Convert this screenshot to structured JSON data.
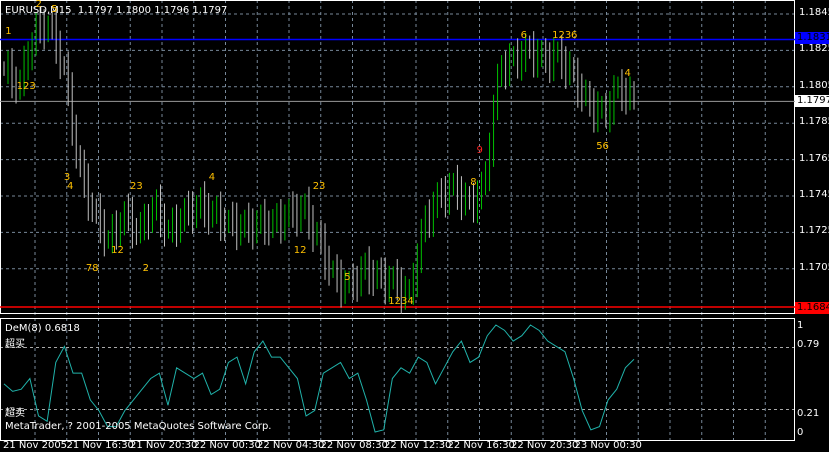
{
  "header": {
    "symbol": "EURUSD,M15",
    "open": "1.1797",
    "high": "1.1800",
    "low": "1.1796",
    "close": "1.1797"
  },
  "price_axis": {
    "ticks": [
      "1.1845",
      "1.1825",
      "1.1805",
      "1.1785",
      "1.1765",
      "1.1745",
      "1.1725",
      "1.1705"
    ],
    "tick_values": [
      1.1845,
      1.1825,
      1.1805,
      1.1785,
      1.1765,
      1.1745,
      1.1725,
      1.1705
    ],
    "blue_line": "1.1831",
    "current": "1.1797",
    "red_line": "1.1684"
  },
  "indicator": {
    "title": "DeM(8) 0.6818",
    "overbought_label": "超买",
    "oversold_label": "超卖",
    "ticks": [
      "1",
      "0.79",
      "0.21",
      "0"
    ],
    "copyright": "MetaTrader, ? 2001-2005 MetaQuotes Software Corp."
  },
  "time_axis": [
    "21 Nov 2005",
    "21 Nov 16:30",
    "21 Nov 20:30",
    "22 Nov 00:30",
    "22 Nov 04:30",
    "22 Nov 08:30",
    "22 Nov 12:30",
    "22 Nov 16:30",
    "22 Nov 20:30",
    "23 Nov 00:30"
  ],
  "colors": {
    "blue": "#0000ff",
    "red": "#ff0000",
    "up": "#00c000",
    "bar": "#c0c0c0",
    "dem": "#20b2aa",
    "label": "#ffc000"
  },
  "chart_data": {
    "type": "bar",
    "price_path": [
      1.1815,
      1.1805,
      1.1835,
      1.184,
      1.1815,
      1.176,
      1.1735,
      1.172,
      1.1735,
      1.1725,
      1.174,
      1.1725,
      1.1735,
      1.174,
      1.1735,
      1.173,
      1.1728,
      1.173,
      1.173,
      1.1735,
      1.1738,
      1.172,
      1.17,
      1.1695,
      1.1705,
      1.17,
      1.1698,
      1.169,
      1.173,
      1.1745,
      1.175,
      1.174,
      1.175,
      1.1815,
      1.182,
      1.1825,
      1.182,
      1.1822,
      1.181,
      1.1795,
      1.179,
      1.1805,
      1.1797
    ],
    "dem": [
      0.45,
      0.38,
      0.4,
      0.5,
      0.15,
      0.1,
      0.65,
      0.8,
      0.55,
      0.55,
      0.3,
      0.2,
      0.05,
      0.05,
      0.2,
      0.3,
      0.4,
      0.5,
      0.55,
      0.25,
      0.6,
      0.55,
      0.5,
      0.55,
      0.35,
      0.4,
      0.65,
      0.7,
      0.45,
      0.75,
      0.85,
      0.7,
      0.7,
      0.6,
      0.5,
      0.15,
      0.2,
      0.55,
      0.6,
      0.65,
      0.5,
      0.55,
      0.3,
      0.0,
      0.02,
      0.5,
      0.6,
      0.55,
      0.7,
      0.65,
      0.45,
      0.6,
      0.75,
      0.85,
      0.65,
      0.7,
      0.9,
      1.0,
      0.95,
      0.85,
      0.9,
      1.0,
      0.95,
      0.85,
      0.8,
      0.75,
      0.5,
      0.2,
      0.02,
      0.05,
      0.3,
      0.4,
      0.6,
      0.68
    ],
    "labels": [
      [
        "1",
        0.002,
        1.1835
      ],
      [
        "2",
        0.05,
        1.185
      ],
      [
        "34",
        0.065,
        1.1855
      ],
      [
        "5",
        0.075,
        1.1847
      ],
      [
        "123",
        0.02,
        1.1805
      ],
      [
        "3",
        0.095,
        1.1755
      ],
      [
        "4",
        0.1,
        1.175
      ],
      [
        "78",
        0.13,
        1.1705
      ],
      [
        "12",
        0.17,
        1.1715
      ],
      [
        "2",
        0.22,
        1.1705
      ],
      [
        "23",
        0.2,
        1.175
      ],
      [
        "4",
        0.325,
        1.1755
      ],
      [
        "23",
        0.49,
        1.175
      ],
      [
        "12",
        0.46,
        1.1715
      ],
      [
        "5",
        0.54,
        1.17
      ],
      [
        "1234",
        0.61,
        1.1687
      ],
      [
        "9",
        0.75,
        1.177
      ],
      [
        "8",
        0.74,
        1.1752
      ],
      [
        "6",
        0.82,
        1.1833
      ],
      [
        "123",
        0.87,
        1.1833
      ],
      [
        "6",
        0.9,
        1.1833
      ],
      [
        "4",
        0.985,
        1.1812
      ],
      [
        "56",
        0.94,
        1.1772
      ]
    ]
  }
}
